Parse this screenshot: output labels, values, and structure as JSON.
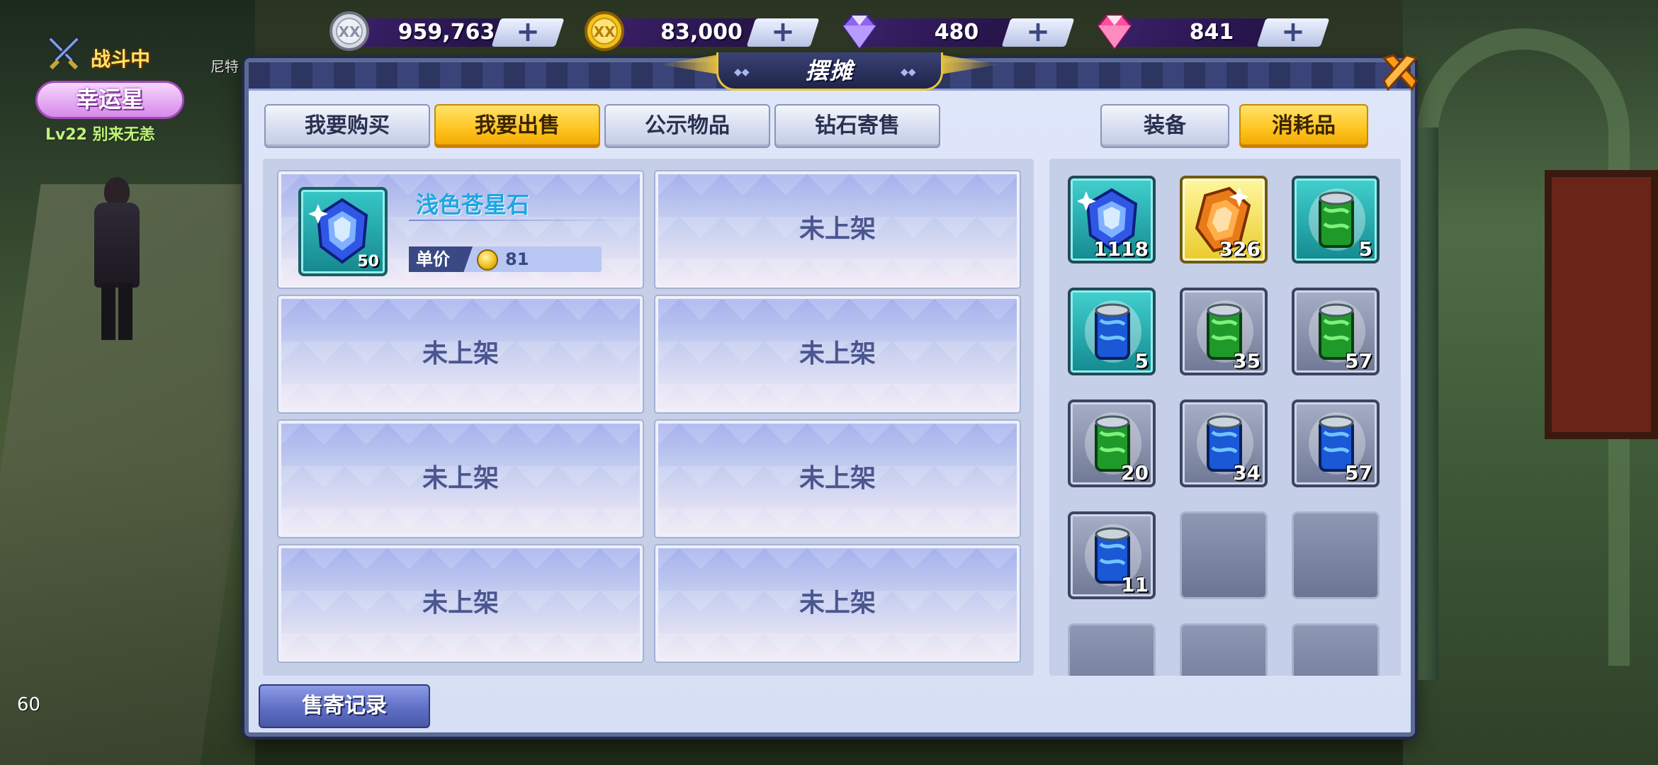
{
  "currencies": [
    {
      "name": "silver-coin",
      "value": "959,763",
      "plus": "+",
      "color": "#c9cdd8"
    },
    {
      "name": "gold-coin",
      "value": "83,000",
      "plus": "+",
      "color": "#f2c120"
    },
    {
      "name": "purple-diamond",
      "value": "480",
      "plus": "+",
      "color": "#9b6bff"
    },
    {
      "name": "pink-diamond",
      "value": "841",
      "plus": "+",
      "color": "#ff6fb7"
    }
  ],
  "hud": {
    "battle_status": "战斗中",
    "title_badge": "幸运星",
    "level_text": "Lv22 别来无恙",
    "npc_name": "尼特"
  },
  "fps": "60",
  "panel": {
    "title": "摆摊",
    "tabs_left": [
      "我要购买",
      "我要出售",
      "公示物品",
      "钻石寄售"
    ],
    "active_left_tab": "我要出售",
    "tabs_right": [
      "装备",
      "消耗品"
    ],
    "active_right_tab": "消耗品"
  },
  "sell_slots": [
    {
      "filled": true,
      "item_name": "浅色苍星石",
      "count": "50",
      "price_label": "单价",
      "price": "81"
    },
    {
      "filled": false,
      "label": "未上架"
    },
    {
      "filled": false,
      "label": "未上架"
    },
    {
      "filled": false,
      "label": "未上架"
    },
    {
      "filled": false,
      "label": "未上架"
    },
    {
      "filled": false,
      "label": "未上架"
    },
    {
      "filled": false,
      "label": "未上架"
    },
    {
      "filled": false,
      "label": "未上架"
    }
  ],
  "inventory": [
    {
      "icon": "blue-gem-icon",
      "frame": "teal",
      "count": "1118"
    },
    {
      "icon": "orange-gem-icon",
      "frame": "gold",
      "count": "326"
    },
    {
      "icon": "green-potion-icon",
      "frame": "teal",
      "count": "5"
    },
    {
      "icon": "blue-potion-icon",
      "frame": "teal",
      "count": "5"
    },
    {
      "icon": "green-potion-icon",
      "frame": "gray",
      "count": "35"
    },
    {
      "icon": "green-potion-icon",
      "frame": "gray",
      "count": "57"
    },
    {
      "icon": "green-potion-icon",
      "frame": "gray",
      "count": "20"
    },
    {
      "icon": "blue-potion-icon",
      "frame": "gray",
      "count": "34"
    },
    {
      "icon": "blue-potion-icon",
      "frame": "gray",
      "count": "57"
    },
    {
      "icon": "blue-potion-icon",
      "frame": "gray",
      "count": "11"
    },
    {
      "icon": "empty",
      "frame": "empty",
      "count": ""
    },
    {
      "icon": "empty",
      "frame": "empty",
      "count": ""
    },
    {
      "icon": "empty",
      "frame": "empty",
      "count": ""
    },
    {
      "icon": "empty",
      "frame": "empty",
      "count": ""
    },
    {
      "icon": "empty",
      "frame": "empty",
      "count": ""
    }
  ],
  "footer": {
    "record_button": "售寄记录"
  }
}
